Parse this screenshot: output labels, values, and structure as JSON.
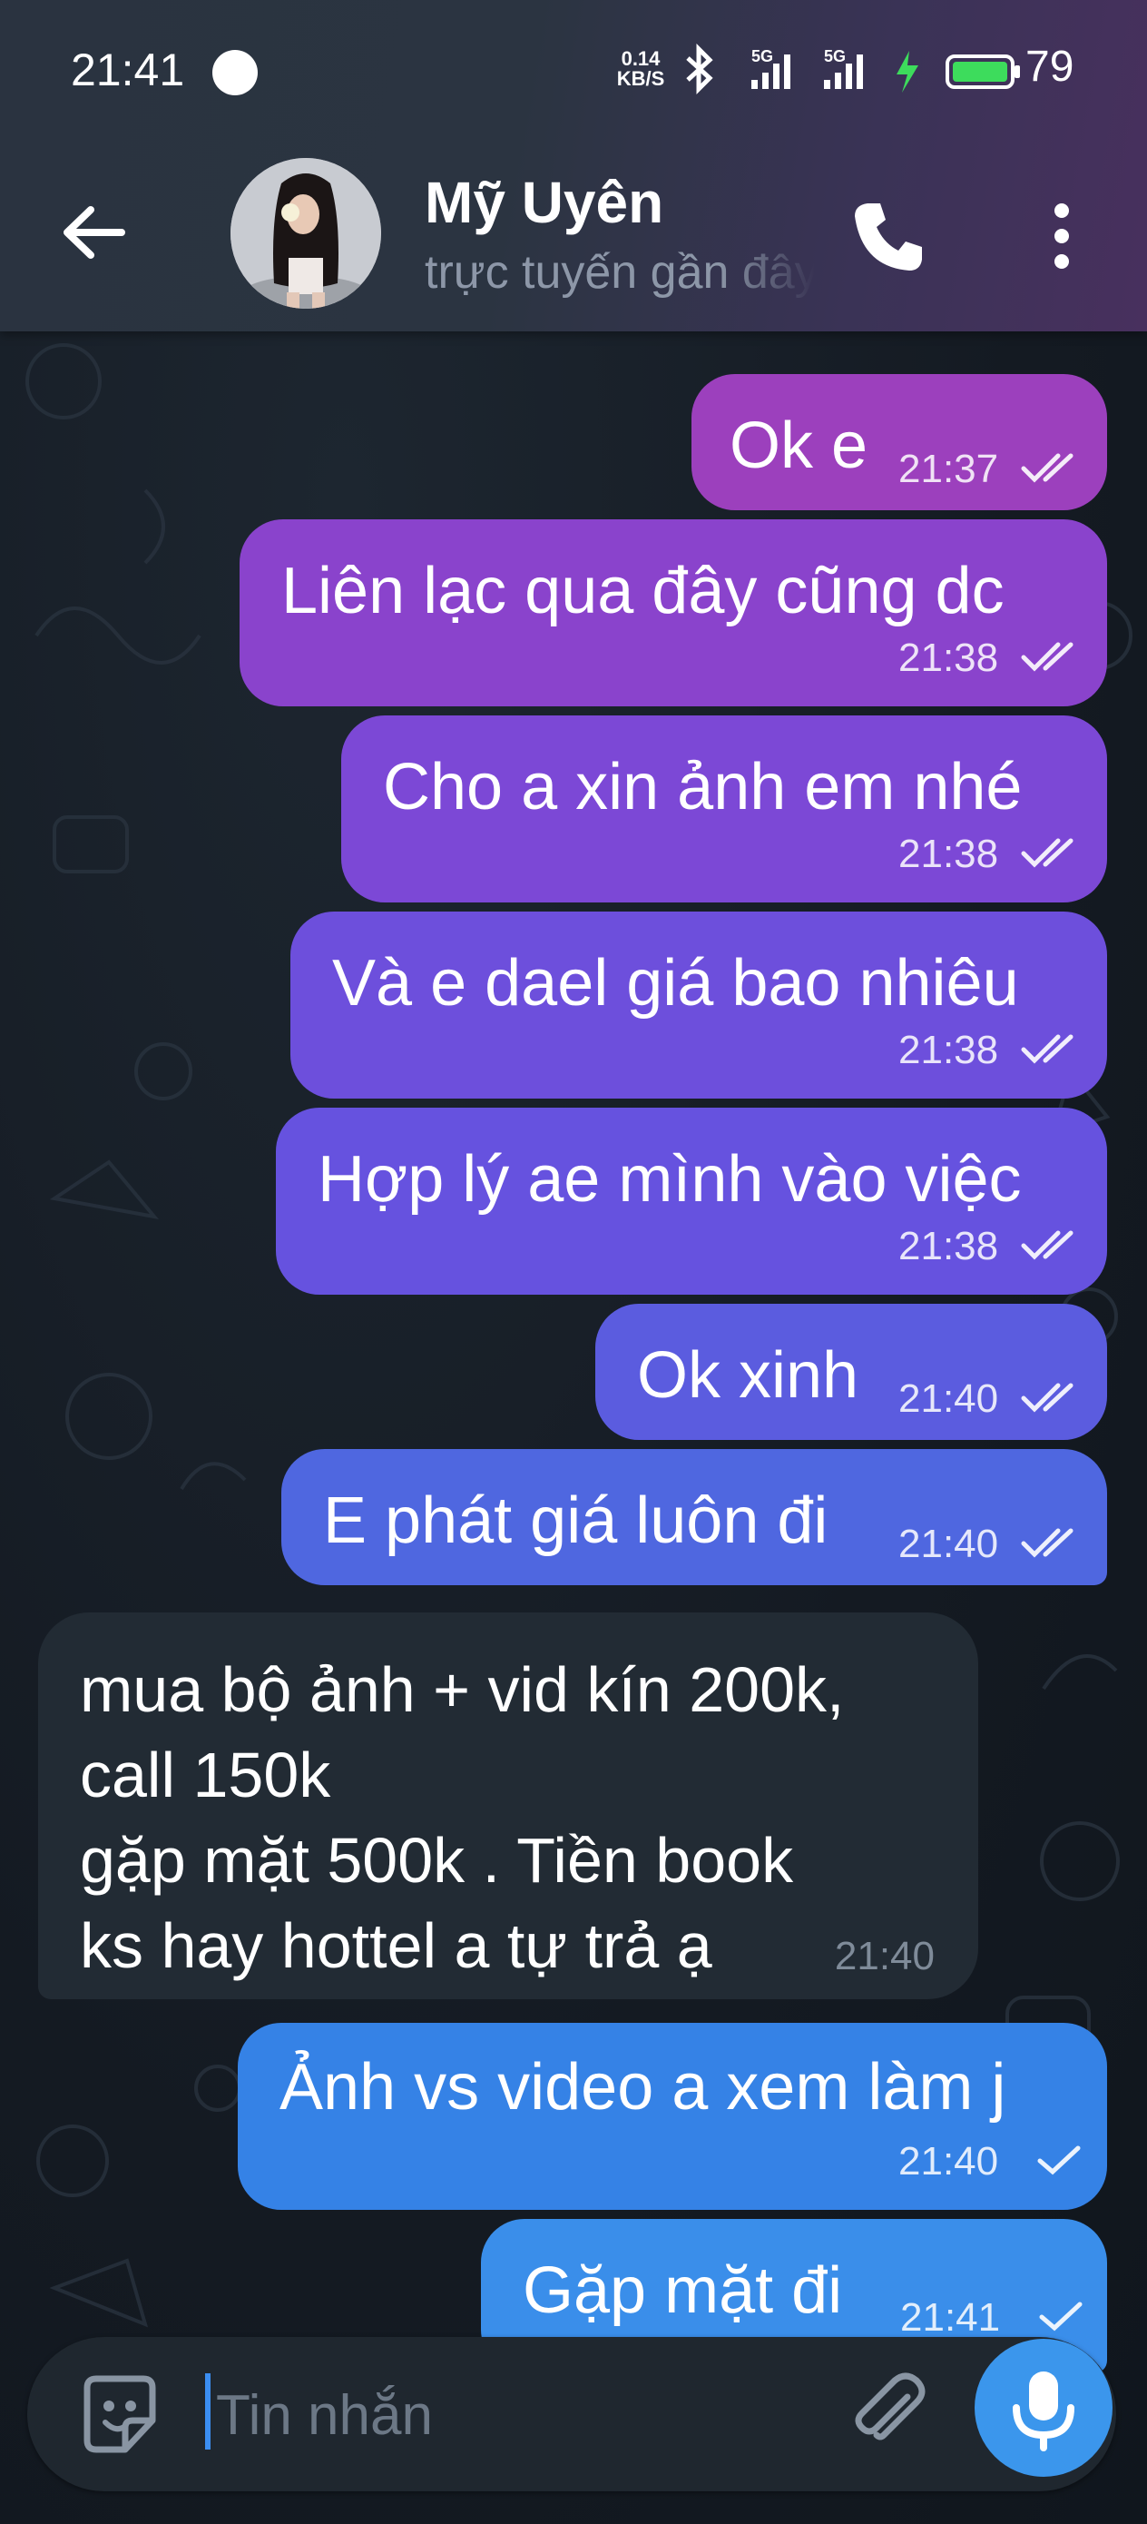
{
  "status_bar": {
    "time": "21:41",
    "net_speed_value": "0.14",
    "net_speed_unit": "KB/S",
    "signal1": "5G",
    "signal2": "5G",
    "battery": "79"
  },
  "header": {
    "contact_name": "Mỹ Uyên",
    "contact_status": "trực tuyến gần đây"
  },
  "messages": [
    {
      "text": "Ok e",
      "time": "21:37",
      "status": "read"
    },
    {
      "text": "Liên lạc qua đây cũng dc",
      "time": "21:38",
      "status": "read"
    },
    {
      "text": "Cho a xin ảnh em nhé",
      "time": "21:38",
      "status": "read"
    },
    {
      "text": "Và e dael giá bao nhiêu",
      "time": "21:38",
      "status": "read"
    },
    {
      "text": "Hợp lý ae mình vào việc",
      "time": "21:38",
      "status": "read"
    },
    {
      "text": "Ok xinh",
      "time": "21:40",
      "status": "read"
    },
    {
      "text": "E phát giá luôn đi",
      "time": "21:40",
      "status": "read"
    },
    {
      "text": "mua bộ ảnh + vid kín 200k,\ncall 150k\ngặp mặt 500k . Tiền book\nks hay hottel a tự trả ạ",
      "time": "21:40",
      "status": "incoming"
    },
    {
      "text": "Ảnh vs video a xem làm j",
      "time": "21:40",
      "status": "sent"
    },
    {
      "text": "Gặp mặt đi",
      "time": "21:41",
      "status": "sent"
    }
  ],
  "composer": {
    "placeholder": "Tin nhắn"
  },
  "colors": {
    "header_bg": "#2b3441",
    "bubble_1": "#9c40bd",
    "bubble_2": "#8a43cc",
    "bubble_3": "#7c48d6",
    "bubble_4": "#6d4fdc",
    "bubble_5": "#6652df",
    "bubble_6": "#5b5cdf",
    "bubble_7": "#4f67e0",
    "bubble_incoming": "#222b34",
    "bubble_9": "#3582e6",
    "bubble_10": "#3a8eea",
    "mic_button": "#3b96ec"
  },
  "icons": {
    "back": "arrow-left-icon",
    "call": "phone-icon",
    "more": "more-vertical-icon",
    "sticker": "sticker-smile-icon",
    "attach": "paperclip-icon",
    "mic": "microphone-icon"
  }
}
